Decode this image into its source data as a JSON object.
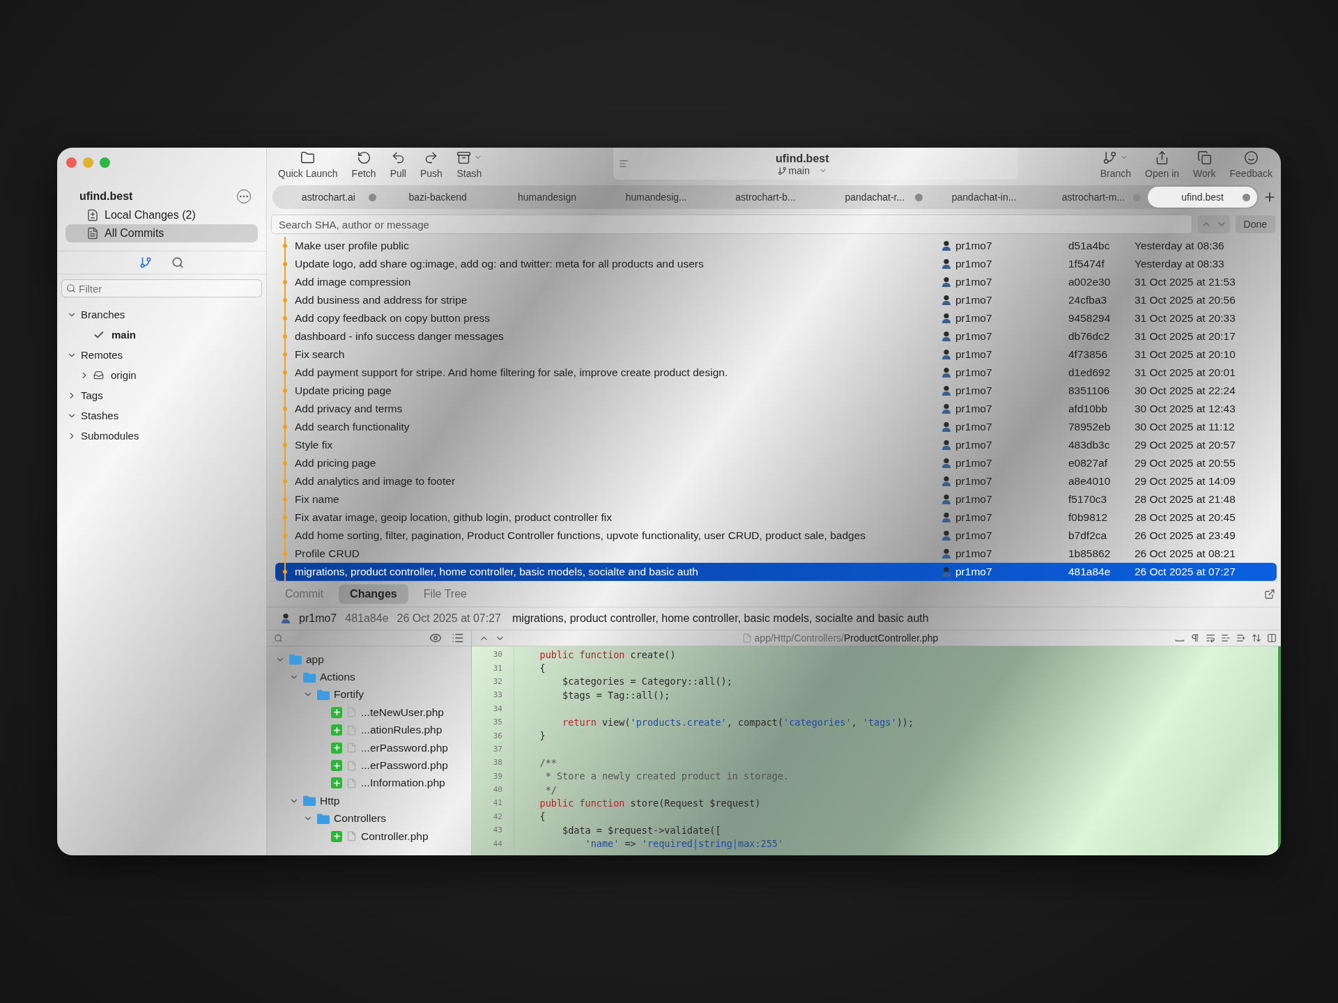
{
  "window": {
    "title": "ufind.best",
    "branch": "main"
  },
  "toolbar": {
    "left": [
      {
        "label": "Quick Launch",
        "kind": "folder",
        "menu": false
      },
      {
        "label": "Fetch",
        "kind": "fetch",
        "menu": false
      },
      {
        "label": "Pull",
        "kind": "pull",
        "menu": false
      },
      {
        "label": "Push",
        "kind": "push",
        "menu": false
      },
      {
        "label": "Stash",
        "kind": "stash",
        "menu": true
      }
    ],
    "right": [
      {
        "label": "Branch",
        "kind": "branch",
        "menu": true
      },
      {
        "label": "Open in",
        "kind": "share",
        "menu": false
      },
      {
        "label": "Work",
        "kind": "work",
        "menu": false
      },
      {
        "label": "Feedback",
        "kind": "feedback",
        "menu": false
      }
    ]
  },
  "repo_tabs": [
    {
      "label": "astrochart.ai",
      "selected": false,
      "dot": true
    },
    {
      "label": "bazi-backend",
      "selected": false,
      "dot": false
    },
    {
      "label": "humandesign",
      "selected": false,
      "dot": false
    },
    {
      "label": "humandesig...",
      "selected": false,
      "dot": false
    },
    {
      "label": "astrochart-b...",
      "selected": false,
      "dot": false
    },
    {
      "label": "pandachat-r...",
      "selected": false,
      "dot": true
    },
    {
      "label": "pandachat-in...",
      "selected": false,
      "dot": false
    },
    {
      "label": "astrochart-m...",
      "selected": false,
      "dot": true
    },
    {
      "label": "ufind.best",
      "selected": true,
      "dot": true
    }
  ],
  "search": {
    "placeholder": "Search SHA, author or message",
    "done": "Done"
  },
  "sidebar": {
    "repo": "ufind.best",
    "items": [
      {
        "label": "Local Changes (2)",
        "kind": "changes",
        "selected": false
      },
      {
        "label": "All Commits",
        "kind": "commits",
        "selected": true
      }
    ],
    "modes": [
      {
        "kind": "branches",
        "selected": true
      },
      {
        "kind": "search",
        "selected": false
      }
    ],
    "filter": {
      "placeholder": "Filter"
    },
    "tree": [
      {
        "label": "Branches",
        "kind": "section",
        "expanded": true,
        "children": [
          {
            "label": "main",
            "kind": "branch",
            "current": true
          }
        ]
      },
      {
        "label": "Remotes",
        "kind": "section",
        "expanded": true,
        "children": [
          {
            "label": "origin",
            "kind": "remote",
            "expanded": false
          }
        ]
      },
      {
        "label": "Tags",
        "kind": "section",
        "expanded": false
      },
      {
        "label": "Stashes",
        "kind": "section",
        "expanded": true
      },
      {
        "label": "Submodules",
        "kind": "section",
        "expanded": false
      }
    ]
  },
  "commits": [
    {
      "message": "Make user profile public",
      "author": "pr1mo7",
      "sha": "d51a4bc",
      "date": "Yesterday at 08:36",
      "selected": false
    },
    {
      "message": "Update logo, add share og:image, add og: and twitter: meta for all products and users",
      "author": "pr1mo7",
      "sha": "1f5474f",
      "date": "Yesterday at 08:33",
      "selected": false
    },
    {
      "message": "Add image compression",
      "author": "pr1mo7",
      "sha": "a002e30",
      "date": "31 Oct 2025 at 21:53",
      "selected": false
    },
    {
      "message": "Add business and address for stripe",
      "author": "pr1mo7",
      "sha": "24cfba3",
      "date": "31 Oct 2025 at 20:56",
      "selected": false
    },
    {
      "message": "Add copy feedback on copy button press",
      "author": "pr1mo7",
      "sha": "9458294",
      "date": "31 Oct 2025 at 20:33",
      "selected": false
    },
    {
      "message": "dashboard - info success danger messages",
      "author": "pr1mo7",
      "sha": "db76dc2",
      "date": "31 Oct 2025 at 20:17",
      "selected": false
    },
    {
      "message": "Fix search",
      "author": "pr1mo7",
      "sha": "4f73856",
      "date": "31 Oct 2025 at 20:10",
      "selected": false
    },
    {
      "message": "Add payment support for stripe. And home filtering for sale, improve create product design.",
      "author": "pr1mo7",
      "sha": "d1ed692",
      "date": "31 Oct 2025 at 20:01",
      "selected": false
    },
    {
      "message": "Update pricing page",
      "author": "pr1mo7",
      "sha": "8351106",
      "date": "30 Oct 2025 at 22:24",
      "selected": false
    },
    {
      "message": "Add privacy and terms",
      "author": "pr1mo7",
      "sha": "afd10bb",
      "date": "30 Oct 2025 at 12:43",
      "selected": false
    },
    {
      "message": "Add search functionality",
      "author": "pr1mo7",
      "sha": "78952eb",
      "date": "30 Oct 2025 at 11:12",
      "selected": false
    },
    {
      "message": "Style fix",
      "author": "pr1mo7",
      "sha": "483db3c",
      "date": "29 Oct 2025 at 20:57",
      "selected": false
    },
    {
      "message": "Add pricing page",
      "author": "pr1mo7",
      "sha": "e0827af",
      "date": "29 Oct 2025 at 20:55",
      "selected": false
    },
    {
      "message": "Add analytics and image to footer",
      "author": "pr1mo7",
      "sha": "a8e4010",
      "date": "29 Oct 2025 at 14:09",
      "selected": false
    },
    {
      "message": "Fix name",
      "author": "pr1mo7",
      "sha": "f5170c3",
      "date": "28 Oct 2025 at 21:48",
      "selected": false
    },
    {
      "message": "Fix avatar image, geoip location, github login, product controller fix",
      "author": "pr1mo7",
      "sha": "f0b9812",
      "date": "28 Oct 2025 at 20:45",
      "selected": false
    },
    {
      "message": "Add home sorting, filter, pagination, Product Controller functions, upvote functionality, user CRUD, product sale, badges",
      "author": "pr1mo7",
      "sha": "b7df2ca",
      "date": "26 Oct 2025 at 23:49",
      "selected": false
    },
    {
      "message": "Profile CRUD",
      "author": "pr1mo7",
      "sha": "1b85862",
      "date": "26 Oct 2025 at 08:21",
      "selected": false
    },
    {
      "message": "migrations, product controller, home controller, basic models, socialte and basic auth",
      "author": "pr1mo7",
      "sha": "481a84e",
      "date": "26 Oct 2025 at 07:27",
      "selected": true
    }
  ],
  "details": {
    "tabs": [
      {
        "label": "Commit",
        "selected": false
      },
      {
        "label": "Changes",
        "selected": true
      },
      {
        "label": "File Tree",
        "selected": false
      }
    ],
    "author": "pr1mo7",
    "sha": "481a84e",
    "date": "26 Oct 2025 at 07:27",
    "message": "migrations, product controller, home controller, basic models, socialte and basic auth"
  },
  "files": [
    {
      "label": "app",
      "expanded": true,
      "children": [
        {
          "label": "Actions",
          "expanded": true,
          "children": [
            {
              "label": "Fortify",
              "expanded": true,
              "children": [
                {
                  "label": "...teNewUser.php",
                  "added": true
                },
                {
                  "label": "...ationRules.php",
                  "added": true
                },
                {
                  "label": "...erPassword.php",
                  "added": true
                },
                {
                  "label": "...erPassword.php",
                  "added": true
                },
                {
                  "label": "...Information.php",
                  "added": true
                }
              ]
            }
          ]
        },
        {
          "label": "Http",
          "expanded": true,
          "children": [
            {
              "label": "Controllers",
              "expanded": true,
              "children": [
                {
                  "label": "Controller.php",
                  "added": true
                }
              ]
            }
          ]
        }
      ]
    }
  ],
  "diff": {
    "folder": "app/Http/Controllers/",
    "file": "ProductController.php",
    "lines": [
      {
        "number": "30",
        "tokens": [
          {
            "kind": "keyword",
            "text": "    public function"
          },
          {
            "kind": "plain",
            "text": " create()"
          }
        ]
      },
      {
        "number": "31",
        "tokens": [
          {
            "kind": "plain",
            "text": "    {"
          }
        ]
      },
      {
        "number": "32",
        "tokens": [
          {
            "kind": "plain",
            "text": "        $categories = Category::all();"
          }
        ]
      },
      {
        "number": "33",
        "tokens": [
          {
            "kind": "plain",
            "text": "        $tags = Tag::all();"
          }
        ]
      },
      {
        "number": "34"
      },
      {
        "number": "35",
        "tokens": [
          {
            "kind": "keyword",
            "text": "        return"
          },
          {
            "kind": "plain",
            "text": " view("
          },
          {
            "kind": "string",
            "text": "'products.create'"
          },
          {
            "kind": "plain",
            "text": ", compact("
          },
          {
            "kind": "string",
            "text": "'categories'"
          },
          {
            "kind": "plain",
            "text": ", "
          },
          {
            "kind": "string",
            "text": "'tags'"
          },
          {
            "kind": "plain",
            "text": "));"
          }
        ]
      },
      {
        "number": "36",
        "tokens": [
          {
            "kind": "plain",
            "text": "    }"
          }
        ]
      },
      {
        "number": "37"
      },
      {
        "number": "38",
        "tokens": [
          {
            "kind": "comment",
            "text": "    /**"
          }
        ]
      },
      {
        "number": "39",
        "tokens": [
          {
            "kind": "comment",
            "text": "     * Store a newly created product in storage."
          }
        ]
      },
      {
        "number": "40",
        "tokens": [
          {
            "kind": "comment",
            "text": "     */"
          }
        ]
      },
      {
        "number": "41",
        "tokens": [
          {
            "kind": "keyword",
            "text": "    public function"
          },
          {
            "kind": "plain",
            "text": " store(Request $request)"
          }
        ]
      },
      {
        "number": "42",
        "tokens": [
          {
            "kind": "plain",
            "text": "    {"
          }
        ]
      },
      {
        "number": "43",
        "tokens": [
          {
            "kind": "plain",
            "text": "        $data = $request->validate(["
          }
        ]
      },
      {
        "number": "44",
        "tokens": [
          {
            "kind": "string",
            "text": "            'name'"
          },
          {
            "kind": "plain",
            "text": " => "
          },
          {
            "kind": "string",
            "text": "'required|string|max:255'"
          }
        ]
      }
    ]
  }
}
